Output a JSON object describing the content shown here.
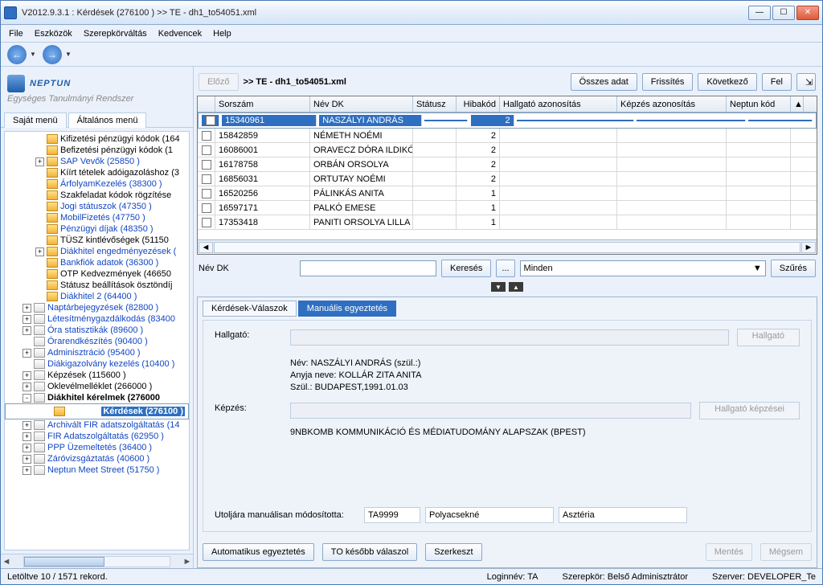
{
  "window": {
    "title": "V2012.9.3.1 : Kérdések (276100  )  >> TE - dh1_to54051.xml"
  },
  "menubar": [
    "File",
    "Eszközök",
    "Szerepkörváltás",
    "Kedvencek",
    "Help"
  ],
  "logo": {
    "brand": "NEPTUN",
    "sub": "Egységes Tanulmányi Rendszer"
  },
  "left_tabs": {
    "t1": "Saját menü",
    "t2": "Általános menü"
  },
  "tree": [
    {
      "ind": 2,
      "exp": "",
      "icon": "f",
      "label": "Kifizetési pénzügyi kódok (164",
      "link": false
    },
    {
      "ind": 2,
      "exp": "",
      "icon": "f",
      "label": "Befizetési pénzügyi kódok (1",
      "link": false
    },
    {
      "ind": 2,
      "exp": "+",
      "icon": "f",
      "label": "SAP Vevők (25850  )",
      "link": true
    },
    {
      "ind": 2,
      "exp": "",
      "icon": "f",
      "label": "Kíírt tételek adóigazoláshoz (3",
      "link": false
    },
    {
      "ind": 2,
      "exp": "",
      "icon": "f",
      "label": "ÁrfolyamKezelés (38300  )",
      "link": true
    },
    {
      "ind": 2,
      "exp": "",
      "icon": "f",
      "label": "Szakfeladat kódok rögzítése",
      "link": false
    },
    {
      "ind": 2,
      "exp": "",
      "icon": "f",
      "label": "Jogi státuszok (47350  )",
      "link": true
    },
    {
      "ind": 2,
      "exp": "",
      "icon": "f",
      "label": "MobilFizetés (47750  )",
      "link": true
    },
    {
      "ind": 2,
      "exp": "",
      "icon": "f",
      "label": "Pénzügyi díjak (48350  )",
      "link": true
    },
    {
      "ind": 2,
      "exp": "",
      "icon": "f",
      "label": "TÜSZ kintlévőségek (51150",
      "link": false
    },
    {
      "ind": 2,
      "exp": "+",
      "icon": "f",
      "label": "Diákhitel engedményezések (",
      "link": true
    },
    {
      "ind": 2,
      "exp": "",
      "icon": "f",
      "label": "Bankfiók adatok (36300  )",
      "link": true
    },
    {
      "ind": 2,
      "exp": "",
      "icon": "f",
      "label": "OTP Kedvezmények (46650",
      "link": false
    },
    {
      "ind": 2,
      "exp": "",
      "icon": "f",
      "label": "Státusz beállítások ösztöndíj",
      "link": false
    },
    {
      "ind": 2,
      "exp": "",
      "icon": "f",
      "label": "Diákhitel 2 (64400  )",
      "link": true
    },
    {
      "ind": 1,
      "exp": "+",
      "icon": "d",
      "label": "Naptárbejegyzések (82800  )",
      "link": true
    },
    {
      "ind": 1,
      "exp": "+",
      "icon": "d",
      "label": "Létesítménygazdálkodás (83400",
      "link": true
    },
    {
      "ind": 1,
      "exp": "+",
      "icon": "d",
      "label": "Óra statisztikák (89600  )",
      "link": true
    },
    {
      "ind": 1,
      "exp": "",
      "icon": "d",
      "label": "Órarendkészítés (90400  )",
      "link": true
    },
    {
      "ind": 1,
      "exp": "+",
      "icon": "d",
      "label": "Adminisztráció (95400  )",
      "link": true
    },
    {
      "ind": 1,
      "exp": "",
      "icon": "d",
      "label": "Diákigazolvány kezelés (10400  )",
      "link": true
    },
    {
      "ind": 1,
      "exp": "+",
      "icon": "d",
      "label": "Képzések (115600  )",
      "link": false
    },
    {
      "ind": 1,
      "exp": "+",
      "icon": "d",
      "label": "Oklevélmelléklet (266000  )",
      "link": false
    },
    {
      "ind": 1,
      "exp": "-",
      "icon": "d",
      "label": "Diákhitel kérelmek (276000",
      "link": false,
      "bold": true
    },
    {
      "ind": 2,
      "exp": "",
      "icon": "f",
      "label": "Kérdések (276100  )",
      "link": true,
      "bold": true,
      "sel": true
    },
    {
      "ind": 1,
      "exp": "+",
      "icon": "d",
      "label": "Archivált FIR adatszolgáltatás (14",
      "link": true
    },
    {
      "ind": 1,
      "exp": "+",
      "icon": "d",
      "label": "FIR Adatszolgáltatás (62950  )",
      "link": true
    },
    {
      "ind": 1,
      "exp": "+",
      "icon": "d",
      "label": "PPP Üzemeltetés (36400  )",
      "link": true
    },
    {
      "ind": 1,
      "exp": "+",
      "icon": "d",
      "label": "Záróvizsgáztatás (40600  )",
      "link": true
    },
    {
      "ind": 1,
      "exp": "+",
      "icon": "d",
      "label": "Neptun Meet Street (51750  )",
      "link": true
    }
  ],
  "top": {
    "prev": "Előző",
    "crumb": ">> TE - dh1_to54051.xml",
    "all": "Összes adat",
    "refresh": "Frissítés",
    "next": "Következő",
    "up": "Fel"
  },
  "grid": {
    "headers": [
      "",
      "Sorszám",
      "Név DK",
      "Státusz",
      "Hibakód",
      "Hallgató azonosítás",
      "Képzés azonosítás",
      "Neptun kód"
    ],
    "rows": [
      {
        "sel": true,
        "c": [
          "",
          "15340961",
          "NASZÁLYI ANDRÁS",
          "",
          "2",
          "",
          "",
          ""
        ]
      },
      {
        "c": [
          "",
          "15842859",
          "NÉMETH NOÉMI",
          "",
          "2",
          "",
          "",
          ""
        ]
      },
      {
        "c": [
          "",
          "16086001",
          "ORAVECZ DÓRA ILDIKÓ",
          "",
          "2",
          "",
          "",
          ""
        ]
      },
      {
        "c": [
          "",
          "16178758",
          "ORBÁN ORSOLYA",
          "",
          "2",
          "",
          "",
          ""
        ]
      },
      {
        "c": [
          "",
          "16856031",
          "ORTUTAY NOÉMI",
          "",
          "2",
          "",
          "",
          ""
        ]
      },
      {
        "c": [
          "",
          "16520256",
          "PÁLINKÁS ANITA",
          "",
          "1",
          "",
          "",
          ""
        ]
      },
      {
        "c": [
          "",
          "16597171",
          "PALKÓ EMESE",
          "",
          "1",
          "",
          "",
          ""
        ]
      },
      {
        "c": [
          "",
          "17353418",
          "PANITI ORSOLYA LILLA",
          "",
          "1",
          "",
          "",
          ""
        ]
      }
    ]
  },
  "search": {
    "label": "Név DK",
    "btn": "Keresés",
    "dots": "...",
    "filter_value": "Minden",
    "filter_btn": "Szűrés"
  },
  "panel": {
    "tab1": "Kérdések-Válaszok",
    "tab2": "Manuális egyeztetés",
    "hallgato_lbl": "Hallgató:",
    "hallgato_btn": "Hallgató",
    "nev": "Név: NASZÁLYI ANDRÁS   (szül.:)",
    "anyja": "Anyja neve: KOLLÁR ZITA ANITA",
    "szul": "Szül.:  BUDAPEST,1991.01.03",
    "kepzes_lbl": "Képzés:",
    "kepzes_btn": "Hallgató képzései",
    "kepzes_val": "9NBKOMB KOMMUNIKÁCIÓ ÉS MÉDIATUDOMÁNY ALAPSZAK (BPEST)",
    "last_lbl": "Utoljára manuálisan módosította:",
    "last1": "TA9999",
    "last2": "Polyacsekné",
    "last3": "Asztéria"
  },
  "bottom": {
    "b1": "Automatikus egyeztetés",
    "b2": "TO később válaszol",
    "b3": "Szerkeszt",
    "b4": "Mentés",
    "b5": "Mégsem"
  },
  "status": {
    "s1": "Letöltve 10 / 1571 rekord.",
    "s2": "Loginnév: TA",
    "s3": "Szerepkör: Belső Adminisztrátor",
    "s4": "Szerver: DEVELOPER_Te"
  }
}
